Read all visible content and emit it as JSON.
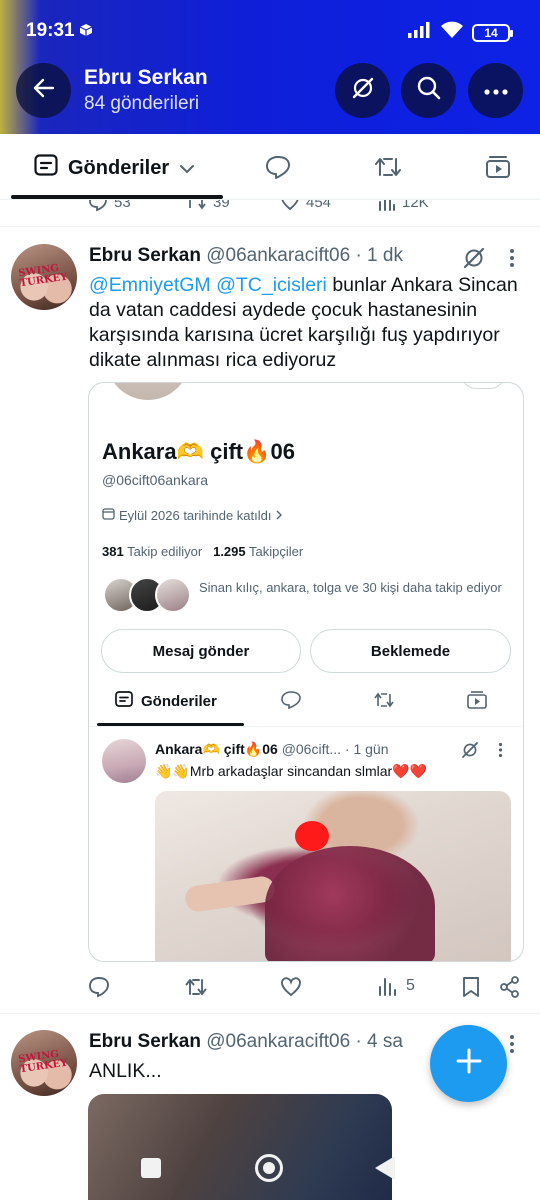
{
  "status_bar": {
    "time": "19:31",
    "battery": "14",
    "icons": [
      "box-icon",
      "signal-icon",
      "wifi-icon",
      "battery-icon"
    ]
  },
  "header": {
    "name": "Ebru Serkan",
    "post_count": "84 gönderileri",
    "buttons": [
      "back-arrow-icon",
      "grok-icon",
      "search-icon",
      "more-icon"
    ]
  },
  "tabs": {
    "active_label": "Gönderiler",
    "icons": [
      "posts-icon",
      "chevron-down-icon",
      "reply-icon",
      "repost-icon",
      "video-icon"
    ]
  },
  "prev_tweet_actions": {
    "replies": "53",
    "reposts": "39",
    "likes": "454",
    "views": "12K"
  },
  "tweet1": {
    "name": "Ebru Serkan",
    "handle": "@06ankaracift06",
    "time": "· 1 dk",
    "mention1": "@EmniyetGM",
    "mention2": "@TC_icisleri",
    "text_line1_rest": "bunlar Ankara",
    "text_rest": "Sincan da vatan caddesi aydede çocuk hastanesinin karşısında karısına ücret karşılığı fuş yapdırıyor  dikate alınması rica ediyoruz",
    "avatar_text_1": "SWING",
    "avatar_text_2": "TURKEY",
    "card": {
      "name": "Ankara🫶 çift🔥06",
      "handle": "@06cift06ankara",
      "joined": "Eylül 2026 tarihinde katıldı",
      "following_count": "381",
      "following_label": "Takip ediliyor",
      "followers_count": "1.295",
      "followers_label": "Takipçiler",
      "followed_by": "Sinan kılıç, ankara, tolga ve 30 kişi daha takip ediyor",
      "message_button": "Mesaj gönder",
      "pending_button": "Beklemede",
      "tab_label": "Gönderiler",
      "inner_tweet": {
        "name": "Ankara🫶 çift🔥06",
        "handle": "@06cift...",
        "time": "· 1 gün",
        "text": "👋👋Mrb arkadaşlar sincandan slmlar❤️❤️"
      }
    },
    "actions": {
      "views": "5"
    }
  },
  "tweet2": {
    "name": "Ebru Serkan",
    "handle": "@06ankaracift06",
    "time": "· 4 sa",
    "text": "ANLIK..."
  },
  "colors": {
    "header_bg": "#0f1fd8",
    "accent": "#1d9bf0",
    "text_primary": "#0f1419",
    "text_secondary": "#536471"
  }
}
